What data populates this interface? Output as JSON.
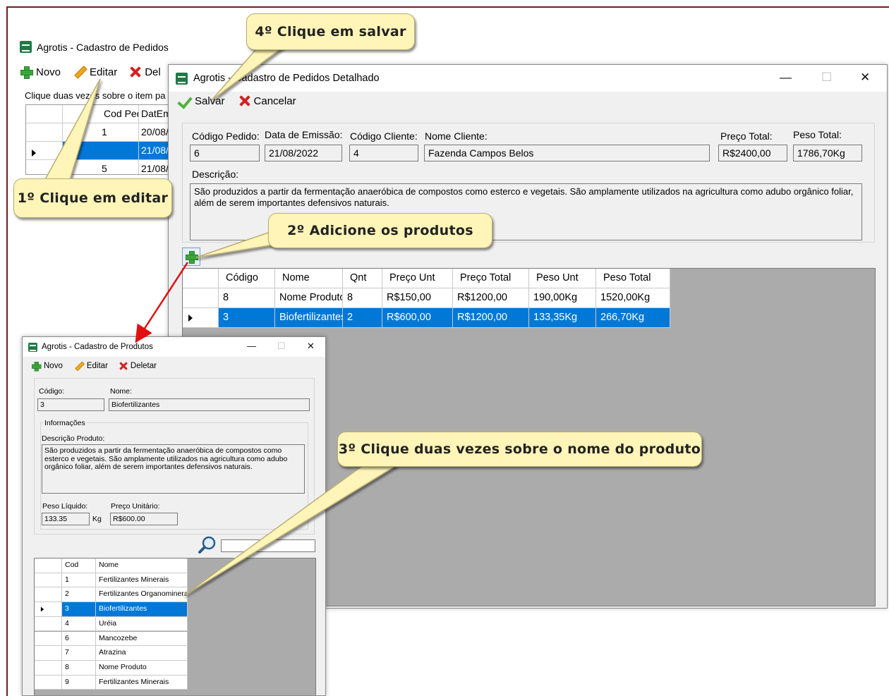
{
  "window_main": {
    "title": "Agrotis - Cadastro de Pedidos",
    "toolbar": {
      "new_label": "Novo",
      "edit_label": "Editar",
      "delete_label": "Del"
    },
    "hint": "Clique duas vezes sobre o item pa",
    "grid": {
      "headers": [
        "",
        "Cod Pedido",
        "DatEm"
      ],
      "rows": [
        {
          "cod": "1",
          "date": "20/08/"
        },
        {
          "cod": "",
          "date": "21/08/"
        },
        {
          "cod": "5",
          "date": "21/08/"
        }
      ]
    }
  },
  "window_order": {
    "title": "Agrotis - Cadastro de Pedidos Detalhado",
    "toolbar": {
      "save_label": "Salvar",
      "cancel_label": "Cancelar"
    },
    "labels": {
      "order_code": "Código Pedido:",
      "issue_date": "Data de Emissão:",
      "client_code": "Código Cliente:",
      "client_name": "Nome Cliente:",
      "total_price": "Preço Total:",
      "total_weight": "Peso Total:",
      "description": "Descrição:"
    },
    "values": {
      "order_code": "6",
      "issue_date": "21/08/2022",
      "client_code": "4",
      "client_name": "Fazenda Campos Belos",
      "total_price": "R$2400,00",
      "total_weight": "1786,70Kg",
      "description": "São produzidos a partir da fermentação anaeróbica de compostos como esterco e vegetais. São amplamente utilizados na agricultura como adubo orgânico foliar, além de serem importantes defensivos naturais."
    },
    "grid": {
      "headers": [
        "Código",
        "Nome",
        "Qnt",
        "Preço Unt",
        "Preço Total",
        "Peso Unt",
        "Peso Total"
      ],
      "rows": [
        [
          "8",
          "Nome Produto",
          "8",
          "R$150,00",
          "R$1200,00",
          "190,00Kg",
          "1520,00Kg"
        ],
        [
          "3",
          "Biofertilizantes",
          "2",
          "R$600,00",
          "R$1200,00",
          "133,35Kg",
          "266,70Kg"
        ]
      ],
      "selected_row": 1
    }
  },
  "window_product": {
    "title": "Agrotis - Cadastro de Produtos",
    "toolbar": {
      "new_label": "Novo",
      "edit_label": "Editar",
      "delete_label": "Deletar"
    },
    "labels": {
      "code": "Código:",
      "name": "Nome:",
      "info_group": "Informações",
      "description": "Descrição Produto:",
      "net_weight": "Peso Líquido:",
      "unit": "Kg",
      "unit_price": "Preço Unitário:"
    },
    "values": {
      "code": "3",
      "name": "Biofertilizantes",
      "description": "São produzidos a partir da fermentação anaeróbica de compostos como esterco e vegetais. São amplamente utilizados na agricultura como adubo orgânico foliar, além de serem importantes defensivos naturais.",
      "net_weight": "133.35",
      "unit_price": "R$600.00",
      "search": ""
    },
    "grid": {
      "headers": [
        "Cod",
        "Nome"
      ],
      "rows": [
        [
          "1",
          "Fertilizantes Minerais"
        ],
        [
          "2",
          "Fertilizantes Organominerais"
        ],
        [
          "3",
          "Biofertilizantes"
        ],
        [
          "4",
          "Uréia"
        ],
        [
          "6",
          "Mancozebe"
        ],
        [
          "7",
          "Atrazina"
        ],
        [
          "8",
          "Nome Produto"
        ],
        [
          "9",
          "Fertilizantes Minerais"
        ]
      ],
      "selected_row": 2
    }
  },
  "callouts": {
    "step1": "1º Clique em editar",
    "step2": "2º Adicione os produtos",
    "step3": "3º Clique duas vezes sobre o nome do produto",
    "step4": "4º Clique em salvar"
  },
  "colors": {
    "selection": "#0078d7",
    "callout_bg": "#fff5b8",
    "arrow": "#e01010",
    "app_logo": "#1f7a45"
  },
  "icons": [
    "app-logo-icon",
    "plus-icon",
    "pencil-icon",
    "x-icon",
    "check-icon",
    "magnifier-icon",
    "minimize-icon",
    "maximize-icon",
    "close-icon",
    "row-pointer-icon"
  ]
}
